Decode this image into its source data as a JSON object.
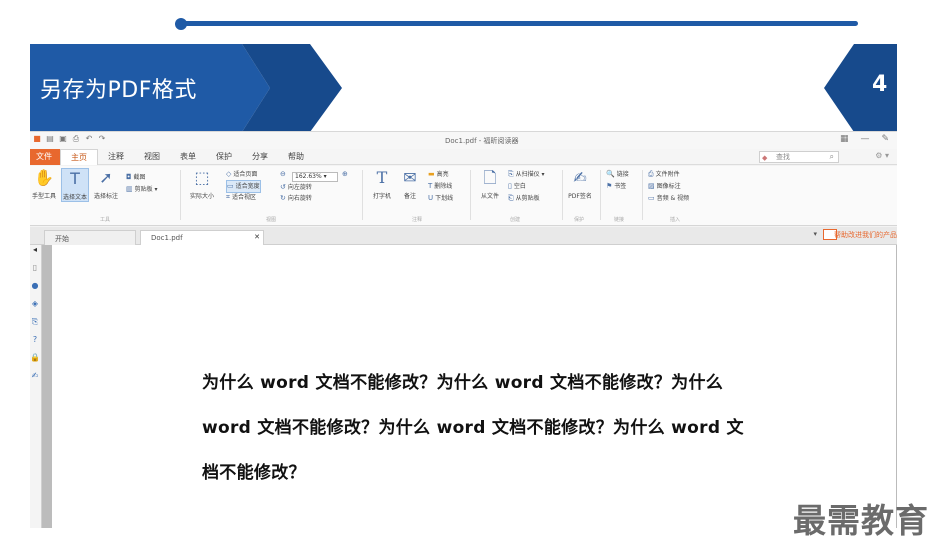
{
  "slide": {
    "banner_title": "另存为PDF格式",
    "page_number": "4",
    "colors": {
      "brand_blue": "#1f5aa6",
      "brand_dark": "#174a8c",
      "accent_orange": "#e8682e"
    }
  },
  "app": {
    "window_title": "Doc1.pdf - 福昕阅读器",
    "quick_access_icons": [
      "app-logo-icon",
      "open-icon",
      "save-icon",
      "print-icon",
      "undo-icon",
      "redo-icon"
    ],
    "tabs": [
      {
        "label": "文件"
      },
      {
        "label": "主页"
      },
      {
        "label": "注释"
      },
      {
        "label": "视图"
      },
      {
        "label": "表单"
      },
      {
        "label": "保护"
      },
      {
        "label": "分享"
      },
      {
        "label": "帮助"
      }
    ],
    "search_placeholder": "查找",
    "ribbon": {
      "hand_tool": "手型工具",
      "select_text": "选择文本",
      "select_annot": "选择标注",
      "snapshot": "截图",
      "clipboard": "剪贴板",
      "actual_size": "实际大小",
      "fit_page": "适合页面",
      "fit_width": "适合宽度",
      "fit_visible": "适合视区",
      "rotate_left": "向左旋转",
      "rotate_right": "向右旋转",
      "zoom_value": "162.63%",
      "typewriter": "打字机",
      "note": "备注",
      "highlight": "高亮",
      "strikeout": "删除线",
      "underline": "下划线",
      "from_file": "从文件",
      "from_scanner": "从扫描仪",
      "blank": "空白",
      "from_clipboard": "从剪贴板",
      "pdf_sign": "PDF签名",
      "link": "链接",
      "bookmark": "书签",
      "file_attach": "文件附件",
      "image_annot": "图像标注",
      "audio_video": "音频 & 视频",
      "groups": {
        "tools": "工具",
        "view": "视图",
        "comment": "注释",
        "create": "创建",
        "protect": "保护",
        "links": "链接",
        "insert": "插入"
      }
    },
    "doc_tabs": [
      {
        "label": "开始"
      },
      {
        "label": "Doc1.pdf"
      }
    ],
    "promo_text": "帮助改进我们的产品",
    "document_lines": [
      "为什么 word 文档不能修改？为什么 word 文档不能修改？为什么",
      "word 文档不能修改？为什么 word 文档不能修改？为什么 word 文",
      "档不能修改？"
    ]
  },
  "watermark": "最需教育"
}
